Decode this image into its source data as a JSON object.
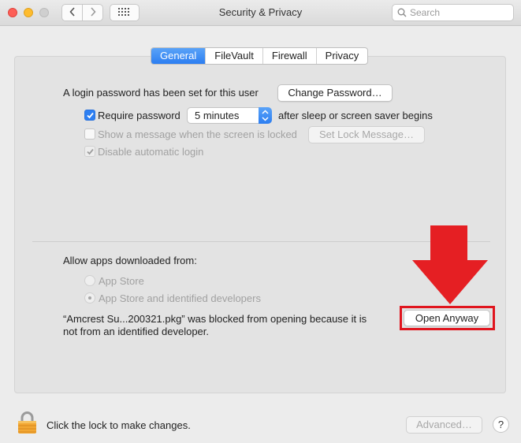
{
  "window": {
    "title": "Security & Privacy",
    "search_placeholder": "Search"
  },
  "tabs": [
    {
      "label": "General",
      "active": true
    },
    {
      "label": "FileVault",
      "active": false
    },
    {
      "label": "Firewall",
      "active": false
    },
    {
      "label": "Privacy",
      "active": false
    }
  ],
  "general": {
    "login_text": "A login password has been set for this user",
    "change_password_label": "Change Password…",
    "require_password_label": "Require password",
    "require_password_checked": true,
    "require_password_value": "5 minutes",
    "require_password_suffix": "after sleep or screen saver begins",
    "show_message_label": "Show a message when the screen is locked",
    "set_lock_message_label": "Set Lock Message…",
    "disable_autologin_label": "Disable automatic login"
  },
  "allow_apps": {
    "heading": "Allow apps downloaded from:",
    "options": [
      "App Store",
      "App Store and identified developers"
    ],
    "selected": "App Store and identified developers",
    "blocked_line1": "“Amcrest Su...200321.pkg” was blocked from opening because it is",
    "blocked_line2": "not from an identified developer.",
    "open_anyway_label": "Open Anyway"
  },
  "footer": {
    "lock_text": "Click the lock to make changes.",
    "advanced_label": "Advanced…",
    "help_label": "?"
  },
  "colors": {
    "accent": "#2c7ef1",
    "annotation_red": "#e0151e"
  }
}
